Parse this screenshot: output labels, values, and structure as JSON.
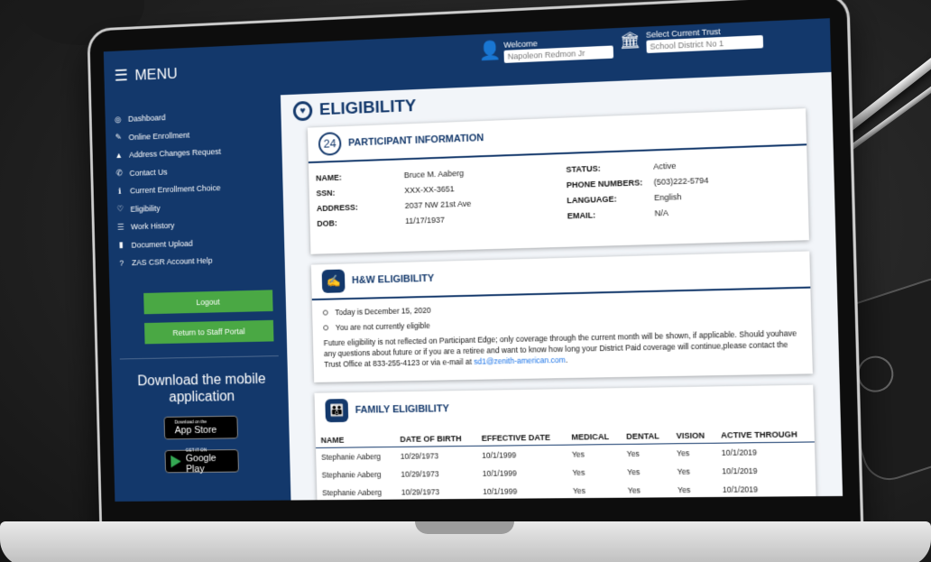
{
  "menu": {
    "label": "MENU"
  },
  "header": {
    "welcome_label": "Welcome",
    "welcome_value": "Napoleon Redmon Jr",
    "trust_label": "Select Current Trust",
    "trust_value": "School District No 1"
  },
  "sidebar": {
    "items": [
      {
        "label": "Dashboard",
        "icon": "dashboard-icon"
      },
      {
        "label": "Online Enrollment",
        "icon": "pencil-icon"
      },
      {
        "label": "Address Changes Request",
        "icon": "road-icon"
      },
      {
        "label": "Contact Us",
        "icon": "phone-icon"
      },
      {
        "label": "Current Enrollment Choice",
        "icon": "info-icon"
      },
      {
        "label": "Eligibility",
        "icon": "heart-icon"
      },
      {
        "label": "Work History",
        "icon": "list-icon"
      },
      {
        "label": "Document Upload",
        "icon": "document-icon"
      },
      {
        "label": "ZAS CSR Account Help",
        "icon": "question-icon"
      }
    ],
    "logout_label": "Logout",
    "staff_label": "Return to Staff Portal",
    "download_label": "Download the mobile application",
    "appstore_small": "Download on the",
    "appstore_label": "App Store",
    "play_small": "GET IT ON",
    "play_label": "Google Play"
  },
  "page": {
    "title": "ELIGIBILITY"
  },
  "participant": {
    "title": "PARTICIPANT INFORMATION",
    "name_key": "NAME:",
    "name": "Bruce M. Aaberg",
    "ssn_key": "SSN:",
    "ssn": "XXX-XX-3651",
    "address_key": "ADDRESS:",
    "address": "2037 NW 21st Ave",
    "dob_key": "DOB:",
    "dob": "11/17/1937",
    "status_key": "STATUS:",
    "status": "Active",
    "phone_key": "PHONE NUMBERS:",
    "phone": "(503)222-5794",
    "language_key": "LANGUAGE:",
    "language": "English",
    "email_key": "EMAIL:",
    "email": "N/A"
  },
  "hw": {
    "title": "H&W ELIGIBILITY",
    "bullet1": "Today is December 15, 2020",
    "bullet2": "You are not currently eligible",
    "note": "Future eligibility is not reflected on Participant Edge; only coverage through the current month will be shown, if applicable. Should youhave any questions about future or if you are a retiree and want to know how long your District Paid coverage will continue,please contact the Trust Office at 833-255-4123 or via e-mail at ",
    "email_link": "sd1@zenith-american.com",
    "note_end": "."
  },
  "family": {
    "title": "FAMILY ELIGIBILITY",
    "headers": [
      "NAME",
      "DATE OF BIRTH",
      "EFFECTIVE DATE",
      "MEDICAL",
      "DENTAL",
      "VISION",
      "ACTIVE THROUGH"
    ],
    "rows": [
      [
        "Stephanie Aaberg",
        "10/29/1973",
        "10/1/1999",
        "Yes",
        "Yes",
        "Yes",
        "10/1/2019"
      ],
      [
        "Stephanie Aaberg",
        "10/29/1973",
        "10/1/1999",
        "Yes",
        "Yes",
        "Yes",
        "10/1/2019"
      ],
      [
        "Stephanie Aaberg",
        "10/29/1973",
        "10/1/1999",
        "Yes",
        "Yes",
        "Yes",
        "10/1/2019"
      ]
    ]
  },
  "colors": {
    "primary": "#13386b",
    "button": "#4aa844",
    "link": "#1a73e8"
  }
}
